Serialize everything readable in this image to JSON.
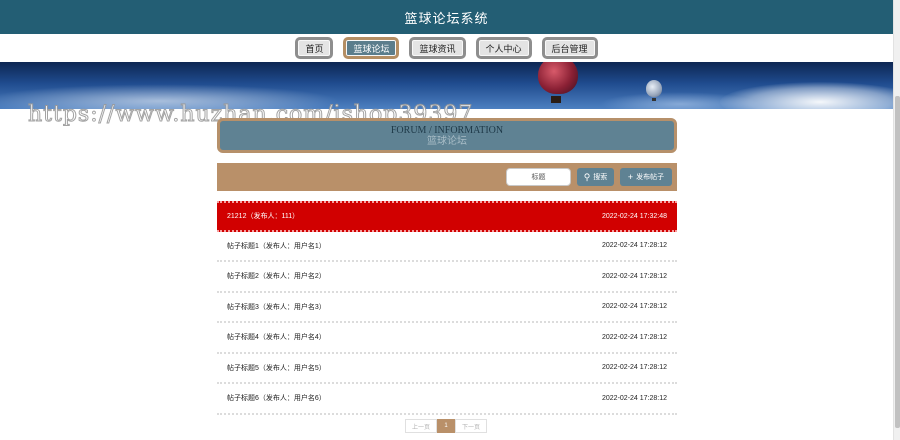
{
  "header": {
    "title": "篮球论坛系统"
  },
  "nav": {
    "items": [
      {
        "label": "首页"
      },
      {
        "label": "篮球论坛"
      },
      {
        "label": "篮球资讯"
      },
      {
        "label": "个人中心"
      },
      {
        "label": "后台管理"
      }
    ],
    "active_index": 1
  },
  "watermark": {
    "text": "https://www.huzhan.com/ishop39397"
  },
  "section": {
    "title_en": "FORUM / INFORMATION",
    "title_cn": "篮球论坛"
  },
  "toolbar": {
    "search_placeholder": "标题",
    "search_label": "搜索",
    "search_icon": "search-icon",
    "post_label": "发布帖子",
    "post_icon": "plus-icon"
  },
  "posts": [
    {
      "title": "21212（发布人：111）",
      "time": "2022-02-24 17:32:48"
    },
    {
      "title": "帖子标题1（发布人：用户名1）",
      "time": "2022-02-24 17:28:12"
    },
    {
      "title": "帖子标题2（发布人：用户名2）",
      "time": "2022-02-24 17:28:12"
    },
    {
      "title": "帖子标题3（发布人：用户名3）",
      "time": "2022-02-24 17:28:12"
    },
    {
      "title": "帖子标题4（发布人：用户名4）",
      "time": "2022-02-24 17:28:12"
    },
    {
      "title": "帖子标题5（发布人：用户名5）",
      "time": "2022-02-24 17:28:12"
    },
    {
      "title": "帖子标题6（发布人：用户名6）",
      "time": "2022-02-24 17:28:12"
    }
  ],
  "pagination": {
    "prev": "上一页",
    "current": "1",
    "next": "下一页"
  },
  "colors": {
    "header_bg": "#235e74",
    "accent_tan": "#b99069",
    "slate": "#5f8293",
    "highlight_red": "#d10000"
  }
}
